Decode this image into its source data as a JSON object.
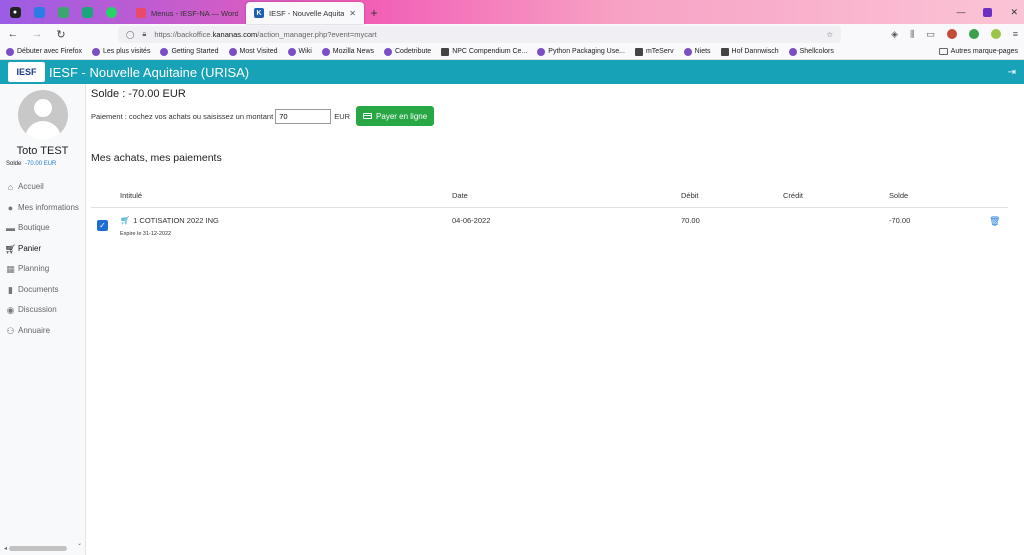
{
  "browser": {
    "tabs": [
      {
        "label": "Menus - IESF-NA — WordPress",
        "favicon_color": "#e94a6a",
        "active": false
      },
      {
        "label": "IESF - Nouvelle Aquitaine (URIS",
        "favicon_color": "#1e5fb4",
        "active": true
      }
    ],
    "url_prefix": "https://backoffice.",
    "url_domain": "kananas.com",
    "url_path": "/action_manager.php?event=mycart",
    "bookmarks": [
      "Débuter avec Firefox",
      "Les plus visités",
      "Getting Started",
      "Most Visited",
      "Wiki",
      "Mozilla News",
      "Codetribute",
      "NPC Compendium Ce...",
      "Python Packaging Use...",
      "mTeServ",
      "Niets",
      "Hof Dannwisch",
      "Shellcolors"
    ],
    "other_bookmarks": "Autres marque-pages"
  },
  "app": {
    "logo_text": "IESF",
    "title": "IESF - Nouvelle Aquitaine (URISA)"
  },
  "user": {
    "name": "Toto TEST",
    "solde_label": "Solde",
    "solde_value": "-70.00 EUR"
  },
  "menu": [
    {
      "label": "Accueil",
      "icon": "home-icon"
    },
    {
      "label": "Mes informations",
      "icon": "user-icon"
    },
    {
      "label": "Boutique",
      "icon": "shop-icon"
    },
    {
      "label": "Panier",
      "icon": "cart-icon",
      "active": true
    },
    {
      "label": "Planning",
      "icon": "calendar-icon"
    },
    {
      "label": "Documents",
      "icon": "document-icon"
    },
    {
      "label": "Discussion",
      "icon": "discussion-icon"
    },
    {
      "label": "Annuaire",
      "icon": "users-icon"
    }
  ],
  "main": {
    "solde_title": "Solde : -70.00 EUR",
    "payment_label": "Paiement : cochez vos achats ou saisissez un montant",
    "amount_value": "70",
    "currency": "EUR",
    "pay_button": "Payer en ligne",
    "section_title": "Mes achats, mes paiements",
    "table": {
      "headers": [
        "Intitulé",
        "Date",
        "Débit",
        "Crédit",
        "Solde"
      ],
      "rows": [
        {
          "checked": true,
          "label": "1 COTISATION 2022 ING",
          "sub": "Expire le 31-12-2022",
          "date": "04-06-2022",
          "debit": "70.00",
          "credit": "",
          "solde": "-70.00"
        }
      ]
    }
  },
  "colors": {
    "header": "#17a2b8",
    "pay_button": "#28a745",
    "checkbox": "#1e6ed4",
    "solde_value": "#1e7bd4"
  }
}
